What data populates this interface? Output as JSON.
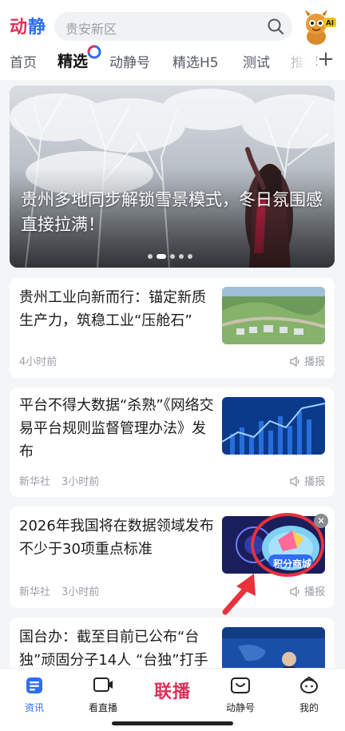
{
  "app": {
    "logo_part1": "动",
    "logo_part2": "静"
  },
  "search": {
    "placeholder": "贵安新区"
  },
  "tabs": [
    {
      "label": "首页"
    },
    {
      "label": "精选"
    },
    {
      "label": "动静号"
    },
    {
      "label": "精选H5"
    },
    {
      "label": "测试"
    },
    {
      "label": "推荐"
    }
  ],
  "banner": {
    "title": "贵州多地同步解锁雪景模式，冬日氛围感直接拉满！",
    "slide_count": 5,
    "active_slide": 2
  },
  "articles": [
    {
      "title": "贵州工业向新而行：锚定新质生产力，筑稳工业“压舱石”",
      "source": "",
      "time": "4小时前",
      "play_label": "播报",
      "thumb": "aerial-industrial-park"
    },
    {
      "title": "平台不得大数据“杀熟”《网络交易平台规则监督管理办法》发布",
      "source": "新华社",
      "time": "3小时前",
      "play_label": "播报",
      "thumb": "blue-data-chart"
    },
    {
      "title": "2026年我国将在数据领域发布不少于30项重点标准",
      "source": "新华社",
      "time": "3小时前",
      "play_label": "播报",
      "thumb": "data-hologram"
    },
    {
      "title": "国台办：截至目前已公布“台独”顽固分子14人 “台独”打手",
      "source": "",
      "time": "",
      "play_label": "",
      "thumb": "press-conference"
    }
  ],
  "float_ad": {
    "label": "积分商城"
  },
  "bottom_nav": [
    {
      "label": "资讯",
      "icon": "news-icon",
      "active": true
    },
    {
      "label": "看直播",
      "icon": "live-tv-icon",
      "active": false
    },
    {
      "label": "联播",
      "icon": "lianbo-logo",
      "active": false
    },
    {
      "label": "动静号",
      "icon": "tv-smile-icon",
      "active": false
    },
    {
      "label": "我的",
      "icon": "profile-icon",
      "active": false
    }
  ],
  "colors": {
    "accent_blue": "#2e6df6",
    "brand_red": "#e0305a",
    "highlight_red": "#e8323c"
  }
}
